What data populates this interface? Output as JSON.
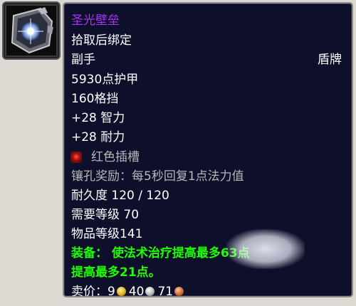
{
  "item": {
    "name": "圣光壁垒",
    "bind": "拾取后绑定",
    "slot": "副手",
    "type": "盾牌",
    "armor": "5930点护甲",
    "block": "160格挡",
    "stat_int": "+28 智力",
    "stat_sta": "+28 耐力",
    "socket_label": "红色插槽",
    "socket_bonus": "镶孔奖励：每5秒回复1点法力值",
    "durability": "耐久度 120 / 120",
    "req_level": "需要等级 70",
    "item_level": "物品等级141",
    "equip_line1": "装备：  使法术治疗提高最多63点",
    "equip_line2": "提高最多21点。",
    "sell_label": "卖价：",
    "sell_gold": "9",
    "sell_silver": "40",
    "sell_copper": "71"
  },
  "colors": {
    "epic": "#a335ee",
    "equip_green": "#1eff00",
    "tooltip_bg": "#0e0f2b"
  },
  "icons": {
    "item": "shield-crystal-icon",
    "socket": "red-socket-icon",
    "gold": "gold-coin-icon",
    "silver": "silver-coin-icon",
    "copper": "copper-coin-icon"
  }
}
